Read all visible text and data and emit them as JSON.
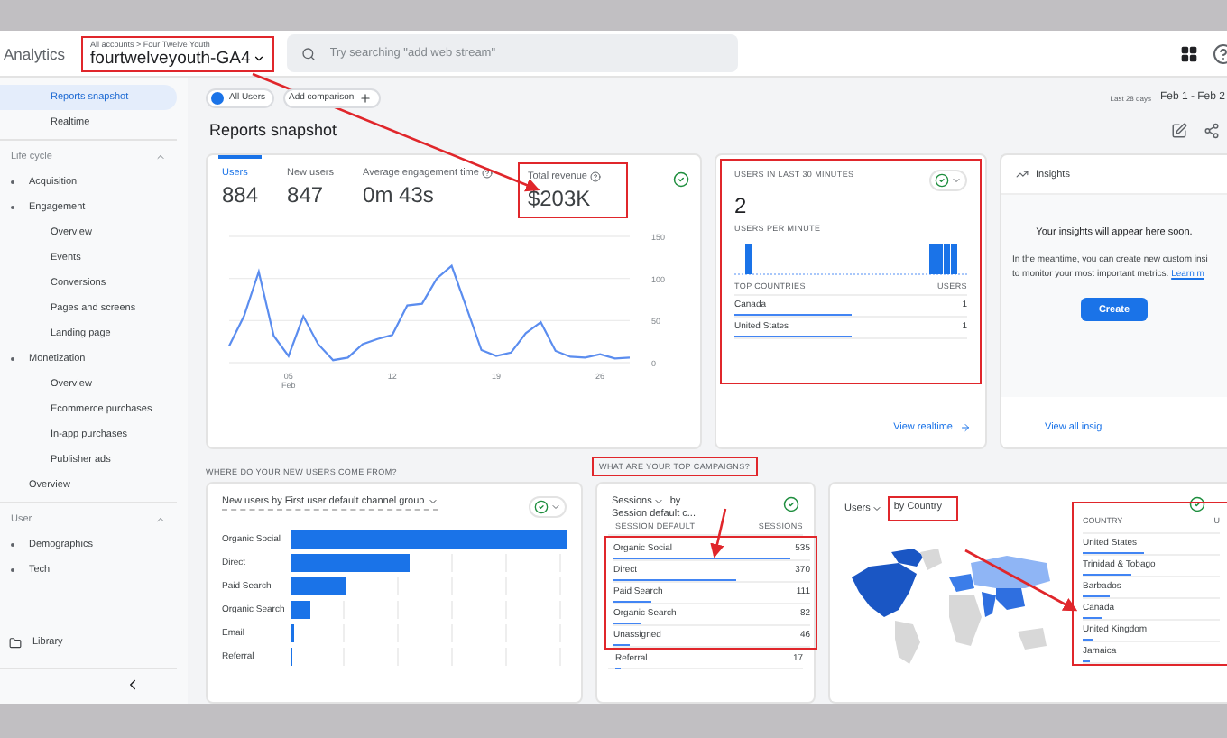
{
  "header": {
    "app_name": "Analytics",
    "breadcrumb": "All accounts > Four Twelve Youth",
    "property": "fourtwelveyouth-GA4",
    "search_placeholder": "Try searching \"add web stream\""
  },
  "sidebar": {
    "items": [
      {
        "label": "Reports snapshot",
        "selected": true
      },
      {
        "label": "Realtime",
        "selected": false
      }
    ],
    "sections": [
      {
        "title": "Life cycle",
        "expanded": true,
        "children": [
          {
            "label": "Acquisition",
            "selected": false,
            "expandable": true
          },
          {
            "label": "Engagement",
            "selected": false,
            "expandable": true,
            "children": [
              {
                "label": "Overview",
                "selected": false
              },
              {
                "label": "Events",
                "selected": false
              },
              {
                "label": "Conversions",
                "selected": false
              },
              {
                "label": "Pages and screens",
                "selected": false
              },
              {
                "label": "Landing page",
                "selected": false
              }
            ]
          },
          {
            "label": "Monetization",
            "selected": false,
            "expandable": true,
            "children": [
              {
                "label": "Overview",
                "selected": false
              },
              {
                "label": "Ecommerce purchases",
                "selected": false
              },
              {
                "label": "In-app purchases",
                "selected": false
              },
              {
                "label": "Publisher ads",
                "selected": false
              }
            ]
          },
          {
            "label": "Overview",
            "selected": false,
            "expandable": false
          }
        ]
      },
      {
        "title": "User",
        "expanded": true,
        "children": [
          {
            "label": "Demographics",
            "selected": false,
            "expandable": true
          },
          {
            "label": "Tech",
            "selected": false,
            "expandable": true
          }
        ]
      }
    ],
    "library": "Library"
  },
  "toolbar": {
    "comparison": "All Users",
    "add_comparison": "Add comparison",
    "date_hint": "Last 28 days",
    "date_range": "Feb 1 - Feb 2"
  },
  "title": "Reports snapshot",
  "overview_card": {
    "metrics": [
      {
        "label": "Users",
        "value": "884",
        "selected": true,
        "help": false
      },
      {
        "label": "New users",
        "value": "847",
        "selected": false,
        "help": false
      },
      {
        "label": "Average engagement time",
        "value": "0m 43s",
        "selected": false,
        "help": true
      },
      {
        "label": "Total revenue",
        "value": "$203K",
        "selected": false,
        "help": true
      }
    ],
    "chart_data": {
      "type": "line",
      "x": [
        1,
        2,
        3,
        4,
        5,
        6,
        7,
        8,
        9,
        10,
        11,
        12,
        13,
        14,
        15,
        16,
        17,
        18,
        19,
        20,
        21,
        22,
        23,
        24,
        25,
        26,
        27,
        28
      ],
      "xlim": [
        1,
        28
      ],
      "ylim": [
        0,
        150
      ],
      "yticks": [
        0,
        50,
        100,
        150
      ],
      "xticks": [
        {
          "value": 5,
          "label": "05 Feb"
        },
        {
          "value": 12,
          "label": "12"
        },
        {
          "value": 19,
          "label": "19"
        },
        {
          "value": 26,
          "label": "26"
        }
      ],
      "series": [
        {
          "color": "#5b8def",
          "values": [
            20,
            55,
            108,
            32,
            8,
            55,
            22,
            3,
            6,
            22,
            28,
            33,
            68,
            70,
            100,
            115,
            65,
            15,
            8,
            12,
            35,
            48,
            14,
            7,
            6,
            10,
            5,
            6
          ]
        }
      ]
    }
  },
  "realtime": {
    "title": "USERS IN LAST 30 MINUTES",
    "value": "2",
    "per_minute_label": "USERS PER MINUTE",
    "countries_header": "TOP COUNTRIES",
    "users_header": "USERS",
    "rows": [
      {
        "name": "Canada",
        "value": "1",
        "level": 0.5
      },
      {
        "name": "United States",
        "value": "1",
        "level": 0.5
      }
    ],
    "link": "View realtime"
  },
  "insights": {
    "title": "Insights",
    "heading": "Your insights will appear here soon.",
    "line_1": "In the meantime, you can create new custom insi",
    "line_2": "to monitor your most important metrics.",
    "link": "Learn m",
    "button": "Create",
    "footer_link": "View all insig"
  },
  "sections": {
    "new_users": "WHERE DO YOUR NEW USERS COME FROM?",
    "campaigns": "WHAT ARE YOUR TOP CAMPAIGNS?"
  },
  "channels": {
    "title": "New users by First user default channel group",
    "rows": [
      {
        "label": "Organic Social",
        "level": 1
      },
      {
        "label": "Direct",
        "level": 0.43
      },
      {
        "label": "Paid Search",
        "level": 0.2
      },
      {
        "label": "Organic Search",
        "level": 0.07
      },
      {
        "label": "Email",
        "level": 0.012
      },
      {
        "label": "Referral",
        "level": 0.006
      }
    ]
  },
  "campaigns": {
    "metric": "Sessions",
    "by": "by",
    "dimension": "Session default c...",
    "column": "SESSION DEFAULT",
    "value_column": "SESSIONS",
    "rows": [
      {
        "name": "Organic Social",
        "value": "535",
        "level": 0.9
      },
      {
        "name": "Direct",
        "value": "370",
        "level": 0.62
      },
      {
        "name": "Paid Search",
        "value": "111",
        "level": 0.19
      },
      {
        "name": "Organic Search",
        "value": "82",
        "level": 0.14
      },
      {
        "name": "Unassigned",
        "value": "46",
        "level": 0.08
      },
      {
        "name": "Referral",
        "value": "17",
        "level": 0.03
      }
    ]
  },
  "countries": {
    "metric": "Users",
    "dimension": "by Country",
    "column": "COUNTRY",
    "value_column": "U",
    "rows": [
      {
        "name": "United States",
        "level": 0.45
      },
      {
        "name": "Trinidad & Tobago",
        "level": 0.36
      },
      {
        "name": "Barbados",
        "level": 0.2
      },
      {
        "name": "Canada",
        "level": 0.15
      },
      {
        "name": "United Kingdom",
        "level": 0.08
      },
      {
        "name": "Jamaica",
        "level": 0.05
      }
    ]
  }
}
